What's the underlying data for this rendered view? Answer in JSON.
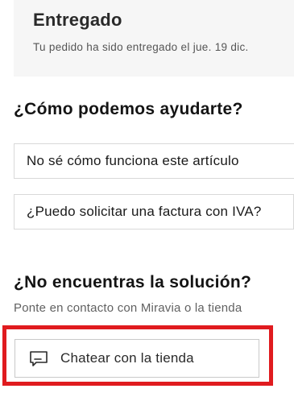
{
  "status": {
    "title": "Entregado",
    "text": "Tu pedido ha sido entregado el jue. 19 dic."
  },
  "help": {
    "heading": "¿Cómo podemos ayudarte?",
    "options": [
      {
        "label": "No sé cómo funciona este artículo"
      },
      {
        "label": "¿Puedo solicitar una factura con IVA?"
      }
    ]
  },
  "contact": {
    "heading": "¿No encuentras la solución?",
    "text": "Ponte en contacto con Miravia o la tienda",
    "chat_button": {
      "label": "Chatear con la tienda",
      "icon": "chat-icon"
    }
  },
  "colors": {
    "highlight": "#e01b1f",
    "card_background": "#f6f6f6"
  }
}
